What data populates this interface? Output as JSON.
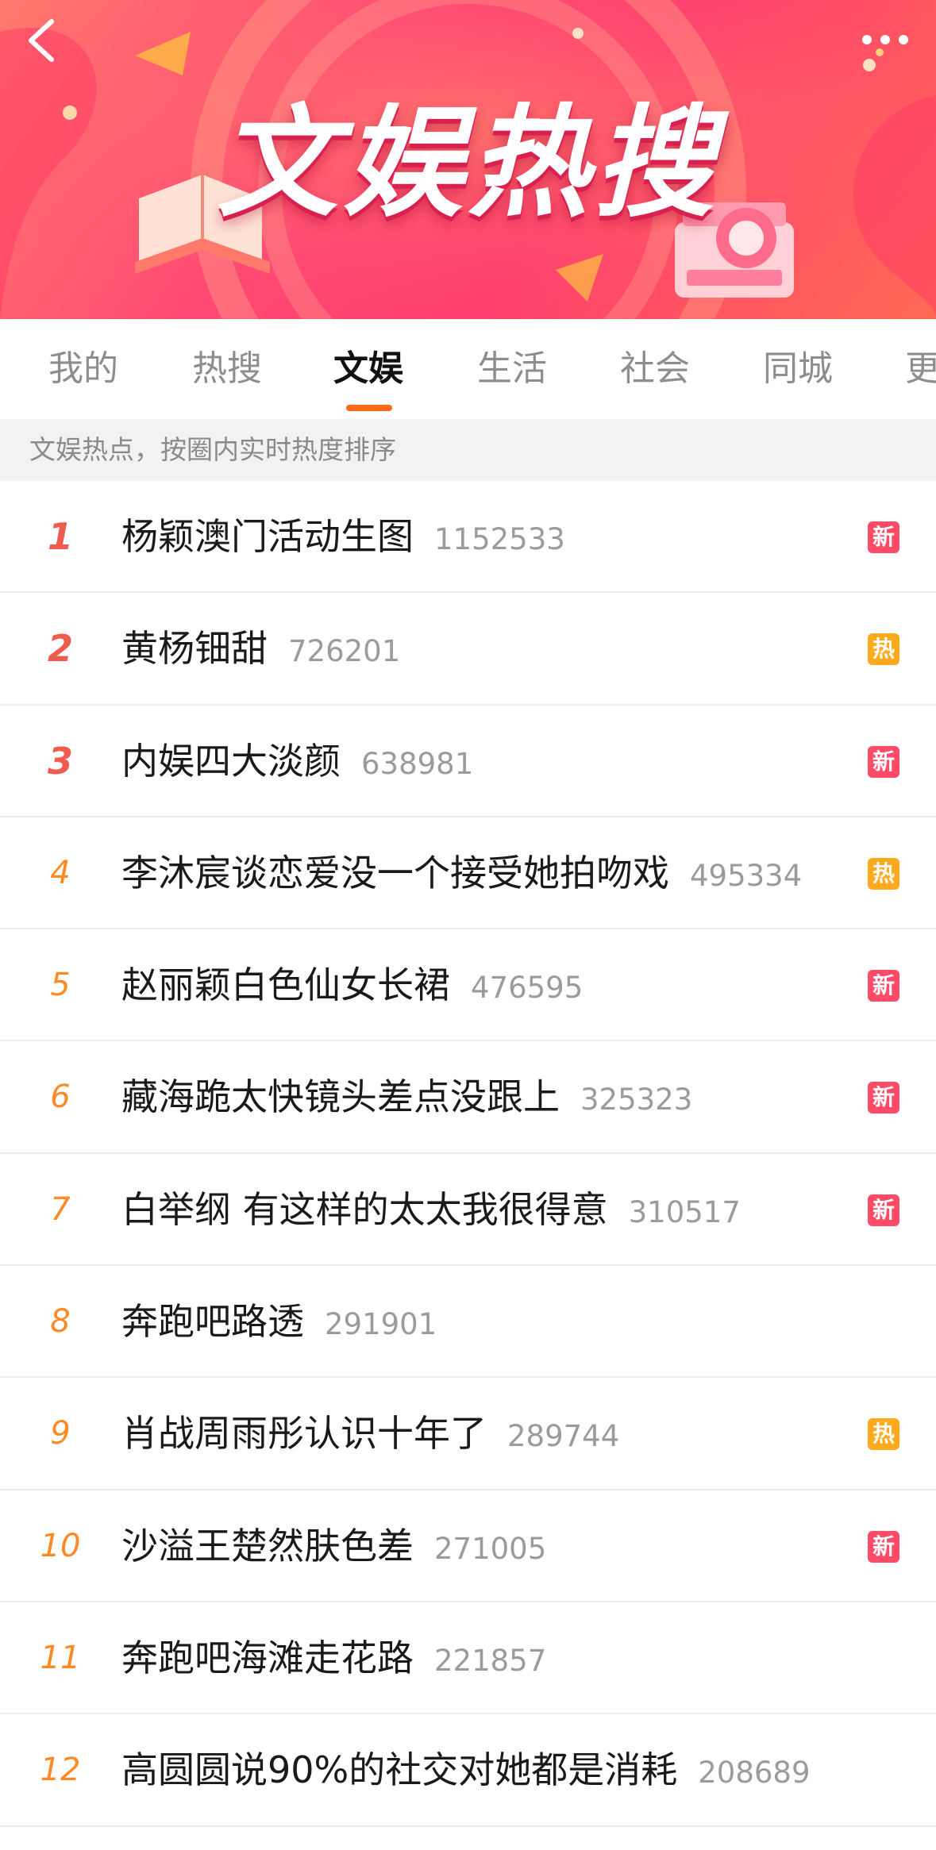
{
  "banner": {
    "title": "文娱热搜"
  },
  "tabs": [
    {
      "label": "我的"
    },
    {
      "label": "热搜"
    },
    {
      "label": "文娱"
    },
    {
      "label": "生活"
    },
    {
      "label": "社会"
    },
    {
      "label": "同城"
    },
    {
      "label": "更"
    }
  ],
  "active_tab": "文娱",
  "subheader": "文娱热点，按圈内实时热度排序",
  "list": [
    {
      "rank": "1",
      "title": "杨颖澳门活动生图",
      "count": "1152533",
      "badge": "新",
      "badge_type": "new"
    },
    {
      "rank": "2",
      "title": "黄杨钿甜",
      "count": "726201",
      "badge": "热",
      "badge_type": "hot"
    },
    {
      "rank": "3",
      "title": "内娱四大淡颜",
      "count": "638981",
      "badge": "新",
      "badge_type": "new"
    },
    {
      "rank": "4",
      "title": "李沐宸谈恋爱没一个接受她拍吻戏",
      "count": "495334",
      "badge": "热",
      "badge_type": "hot"
    },
    {
      "rank": "5",
      "title": "赵丽颖白色仙女长裙",
      "count": "476595",
      "badge": "新",
      "badge_type": "new"
    },
    {
      "rank": "6",
      "title": "藏海跪太快镜头差点没跟上",
      "count": "325323",
      "badge": "新",
      "badge_type": "new"
    },
    {
      "rank": "7",
      "title": "白举纲 有这样的太太我很得意",
      "count": "310517",
      "badge": "新",
      "badge_type": "new"
    },
    {
      "rank": "8",
      "title": "奔跑吧路透",
      "count": "291901",
      "badge": "",
      "badge_type": ""
    },
    {
      "rank": "9",
      "title": "肖战周雨彤认识十年了",
      "count": "289744",
      "badge": "热",
      "badge_type": "hot"
    },
    {
      "rank": "10",
      "title": "沙溢王楚然肤色差",
      "count": "271005",
      "badge": "新",
      "badge_type": "new"
    },
    {
      "rank": "11",
      "title": "奔跑吧海滩走花路",
      "count": "221857",
      "badge": "",
      "badge_type": ""
    },
    {
      "rank": "12",
      "title": "高圆圆说90%的社交对她都是消耗",
      "count": "208689",
      "badge": "",
      "badge_type": ""
    }
  ],
  "colors": {
    "accent": "#ff6a1a",
    "rank_top": "#ef5b4f",
    "rank_other": "#ff8a24",
    "badge_new": "#ff4b67",
    "badge_hot": "#ffaa1c"
  },
  "icons": {
    "back": "chevron-left-icon",
    "more": "more-dots-icon"
  }
}
